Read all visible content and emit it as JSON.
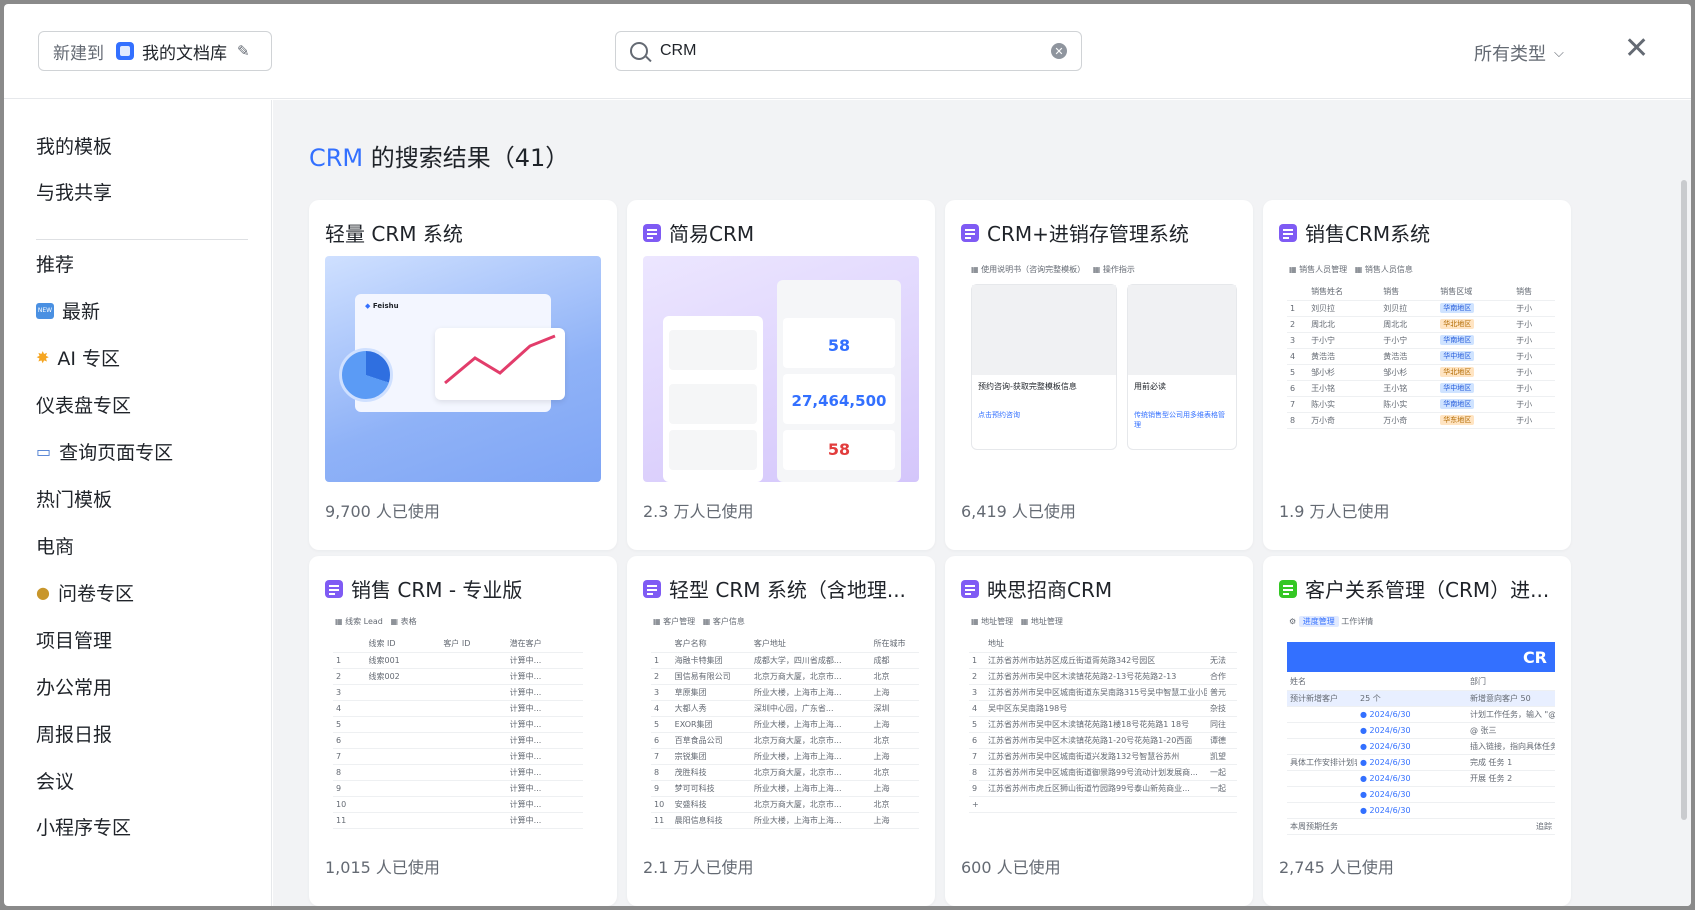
{
  "topbar": {
    "new_to_label": "新建到",
    "library_name": "我的文档库",
    "search_value": "CRM",
    "type_filter": "所有类型"
  },
  "sidebar": {
    "items": [
      {
        "label": "我的模板"
      },
      {
        "label": "与我共享"
      },
      {
        "label": "推荐"
      },
      {
        "label": "最新",
        "icon": "new-badge-icon"
      },
      {
        "label": "AI 专区",
        "icon": "sparkle-icon"
      },
      {
        "label": "仪表盘专区"
      },
      {
        "label": "查询页面专区",
        "icon": "book-icon"
      },
      {
        "label": "热门模板"
      },
      {
        "label": "电商"
      },
      {
        "label": "问卷专区",
        "icon": "person-icon"
      },
      {
        "label": "项目管理"
      },
      {
        "label": "办公常用"
      },
      {
        "label": "周报日报"
      },
      {
        "label": "会议"
      },
      {
        "label": "小程序专区"
      }
    ]
  },
  "results": {
    "keyword": "CRM",
    "title_suffix": " 的搜索结果（41）"
  },
  "cards": [
    {
      "title": "轻量 CRM 系统",
      "usage": "9,700 人已使用",
      "icon": "none"
    },
    {
      "title": "简易CRM",
      "usage": "2.3 万人已使用",
      "icon": "base-icon"
    },
    {
      "title": "CRM+进销存管理系统",
      "usage": "6,419 人已使用",
      "icon": "base-icon"
    },
    {
      "title": "销售CRM系统",
      "usage": "1.9 万人已使用",
      "icon": "base-icon"
    },
    {
      "title": "销售 CRM - 专业版",
      "usage": "1,015 人已使用",
      "icon": "base-icon"
    },
    {
      "title": "轻型 CRM 系统（含地理...",
      "usage": "2.1 万人已使用",
      "icon": "base-icon"
    },
    {
      "title": "映思招商CRM",
      "usage": "600 人已使用",
      "icon": "base-icon"
    },
    {
      "title": "客户关系管理（CRM）进...",
      "usage": "2,745 人已使用",
      "icon": "sheet-icon"
    }
  ],
  "previews": {
    "feishu_label": "Feishu",
    "simple_crm": {
      "v1": "58",
      "v2": "27,464,500",
      "v3": "58"
    },
    "jxc": {
      "tab1": "使用说明书（咨询完整模板）",
      "tab2": "操作指示",
      "c1": "预约咨询-获取完整模板信息",
      "c1link": "点击预约咨询",
      "c2": "用前必读",
      "c2link": "传统销售型公司用多维表格管理"
    },
    "sales_crm": {
      "tab1": "销售人员管理",
      "tab2": "销售人员信息",
      "headers": [
        "销售姓名",
        "销售",
        "销售区域",
        "销售"
      ],
      "rows": [
        [
          "1",
          "刘贝拉",
          "刘贝拉",
          "华南地区",
          "于小"
        ],
        [
          "2",
          "周北北",
          "周北北",
          "华北地区",
          "于小"
        ],
        [
          "3",
          "于小宁",
          "于小宁",
          "华南地区",
          "于小"
        ],
        [
          "4",
          "黄浩浩",
          "黄浩浩",
          "华中地区",
          "于小"
        ],
        [
          "5",
          "邹小杉",
          "邹小杉",
          "华北地区",
          "于小"
        ],
        [
          "6",
          "王小铭",
          "王小铭",
          "华中地区",
          "于小"
        ],
        [
          "7",
          "陈小实",
          "陈小实",
          "华南地区",
          "于小"
        ],
        [
          "8",
          "万小奇",
          "万小奇",
          "华东地区",
          "于小"
        ]
      ]
    },
    "pro": {
      "tab1": "线索 Lead",
      "tab2": "表格",
      "headers": [
        "线索 ID",
        "客户 ID",
        "潜在客户"
      ],
      "rows": [
        [
          "1",
          "线索001",
          "",
          "计算中..."
        ],
        [
          "2",
          "线索002",
          "",
          "计算中..."
        ],
        [
          "3",
          "",
          "",
          "计算中..."
        ],
        [
          "4",
          "",
          "",
          "计算中..."
        ],
        [
          "5",
          "",
          "",
          "计算中..."
        ],
        [
          "6",
          "",
          "",
          "计算中..."
        ],
        [
          "7",
          "",
          "",
          "计算中..."
        ],
        [
          "8",
          "",
          "",
          "计算中..."
        ],
        [
          "9",
          "",
          "",
          "计算中..."
        ],
        [
          "10",
          "",
          "",
          "计算中..."
        ],
        [
          "11",
          "",
          "",
          "计算中..."
        ]
      ]
    },
    "light": {
      "tab1": "客户管理",
      "tab2": "客户信息",
      "headers": [
        "客户名称",
        "客户地址",
        "所在城市"
      ],
      "rows": [
        [
          "1",
          "海融卡特集团",
          "成都大学，四川省成都...",
          "成都"
        ],
        [
          "2",
          "国信易有限公司",
          "北京万商大厦，北京市...",
          "北京"
        ],
        [
          "3",
          "草原集团",
          "所业大楼，上海市上海...",
          "上海"
        ],
        [
          "4",
          "大都人秀",
          "深圳中心园，广东省...",
          "深圳"
        ],
        [
          "5",
          "EXOR集团",
          "所业大楼，上海市上海...",
          "上海"
        ],
        [
          "6",
          "百草食品公司",
          "北京万商大厦，北京市...",
          "北京"
        ],
        [
          "7",
          "宗锐集团",
          "所业大楼，上海市上海...",
          "上海"
        ],
        [
          "8",
          "茂胜科技",
          "北京万商大厦，北京市...",
          "北京"
        ],
        [
          "9",
          "梦可可科技",
          "所业大楼，上海市上海...",
          "上海"
        ],
        [
          "10",
          "安盛科技",
          "北京万商大厦，北京市...",
          "北京"
        ],
        [
          "11",
          "晨阳信息科技",
          "所业大楼，上海市上海...",
          "上海"
        ]
      ]
    },
    "yingsi": {
      "tab1": "地址管理",
      "tab2": "地址管理",
      "header": "地址",
      "rows": [
        [
          "1",
          "江苏省苏州市姑苏区成丘街道胥苑路342号园区",
          "无法"
        ],
        [
          "2",
          "江苏省苏州市吴中区木渎镇花苑路2-13号花苑路2-13",
          "合作"
        ],
        [
          "3",
          "江苏省苏州市吴中区城南街道东吴南路315号吴中智慧工业小区",
          "普元"
        ],
        [
          "4",
          "吴中区东吴南路198号",
          "杂技"
        ],
        [
          "5",
          "江苏省苏州市吴中区木渎镇花苑路1楼18号花苑路1 18号",
          "同往"
        ],
        [
          "6",
          "江苏省苏州市吴中区木渎镇花苑路1-20号花苑路1-20西面",
          "谭德"
        ],
        [
          "7",
          "江苏省苏州市吴中区城南街道兴发路132号智慧谷苏州",
          "凯望"
        ],
        [
          "8",
          "江苏省苏州市吴中区城南街道御景路99号流动计划发展商...",
          "一起"
        ],
        [
          "9",
          "江苏省苏州市虎丘区狮山街道竹园路99号泰山新苑商业...",
          "一起"
        ]
      ]
    },
    "crmsheet": {
      "tab1": "进度管理",
      "tab2": "工作详情",
      "banner": "CR",
      "h_name": "姓名",
      "h_dept": "部门",
      "r_goal": "预计新增客户",
      "r_goal_v": "25 个",
      "r_goal_h": "新增意向客户",
      "r_goal_n": "50",
      "plan": "具体工作安排计划表",
      "tasks": [
        [
          "2024/6/30",
          "计划工作任务，输入 \"@ + 人名\""
        ],
        [
          "2024/6/30",
          "@ 张三"
        ],
        [
          "2024/6/30",
          "插入链接，指向具体任务"
        ],
        [
          "2024/6/30",
          "完成 任务 1"
        ],
        [
          "2024/6/30",
          "开展 任务 2"
        ],
        [
          "2024/6/30",
          ""
        ],
        [
          "2024/6/30",
          ""
        ]
      ],
      "weekly": "本周预期任务",
      "trail": "追踪"
    }
  }
}
